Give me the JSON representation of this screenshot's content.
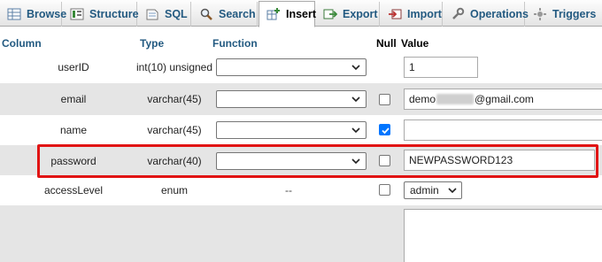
{
  "tabs": [
    {
      "label": "Browse",
      "icon": "browse-icon"
    },
    {
      "label": "Structure",
      "icon": "structure-icon"
    },
    {
      "label": "SQL",
      "icon": "sql-icon"
    },
    {
      "label": "Search",
      "icon": "search-icon"
    },
    {
      "label": "Insert",
      "icon": "insert-icon",
      "active": true
    },
    {
      "label": "Export",
      "icon": "export-icon"
    },
    {
      "label": "Import",
      "icon": "import-icon"
    },
    {
      "label": "Operations",
      "icon": "operations-icon"
    },
    {
      "label": "Triggers",
      "icon": "triggers-icon"
    }
  ],
  "table": {
    "headers": {
      "column": "Column",
      "type": "Type",
      "function": "Function",
      "null": "Null",
      "value": "Value"
    },
    "rows": [
      {
        "column": "userID",
        "type": "int(10) unsigned",
        "function": "",
        "null_checked": false,
        "value": "1"
      },
      {
        "column": "email",
        "type": "varchar(45)",
        "function": "",
        "null_checked": false,
        "value_prefix": "demo",
        "value_suffix": "@gmail.com"
      },
      {
        "column": "name",
        "type": "varchar(45)",
        "function": "",
        "null_checked": true,
        "value": ""
      },
      {
        "column": "password",
        "type": "varchar(40)",
        "function": "",
        "null_checked": false,
        "value": "NEWPASSWORD123"
      },
      {
        "column": "accessLevel",
        "type": "enum",
        "function": "--",
        "null_checked": false,
        "value": "admin"
      }
    ]
  },
  "colors": {
    "highlight": "#e11414",
    "link": "#235a81",
    "checkbox": "#0075ff"
  }
}
